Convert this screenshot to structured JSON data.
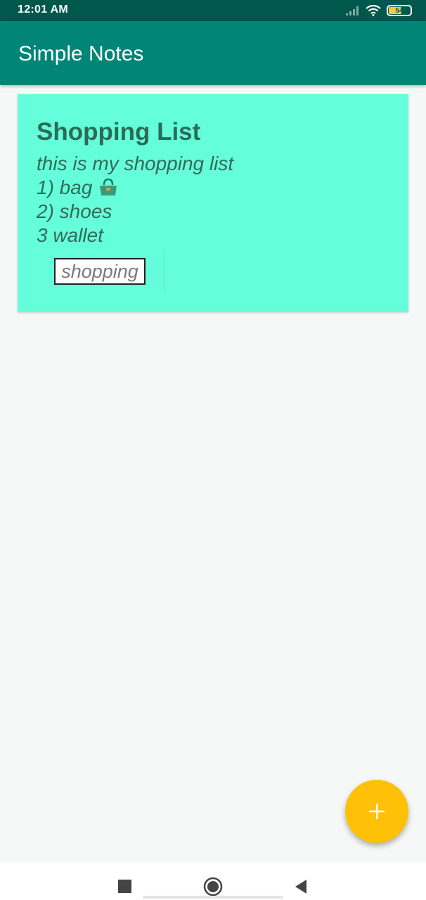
{
  "status_bar": {
    "time": "12:01 AM",
    "battery_level": "54",
    "icons": [
      "signal-icon",
      "wifi-icon",
      "battery-icon"
    ]
  },
  "app_bar": {
    "title": "Simple Notes"
  },
  "notes": [
    {
      "title": "Shopping List",
      "lines": [
        "this is my shopping list",
        "1) bag",
        "2) shoes",
        "3 wallet"
      ],
      "tag": "shopping",
      "color": "#64ffda"
    }
  ],
  "fab": {
    "icon": "plus-icon",
    "color": "#ffc107"
  },
  "navigation_bar": {
    "buttons": [
      "recents-icon",
      "home-icon",
      "back-icon"
    ]
  },
  "colors": {
    "status_bar": "#00574b",
    "app_bar": "#008577",
    "background": "#f6f8f7"
  }
}
